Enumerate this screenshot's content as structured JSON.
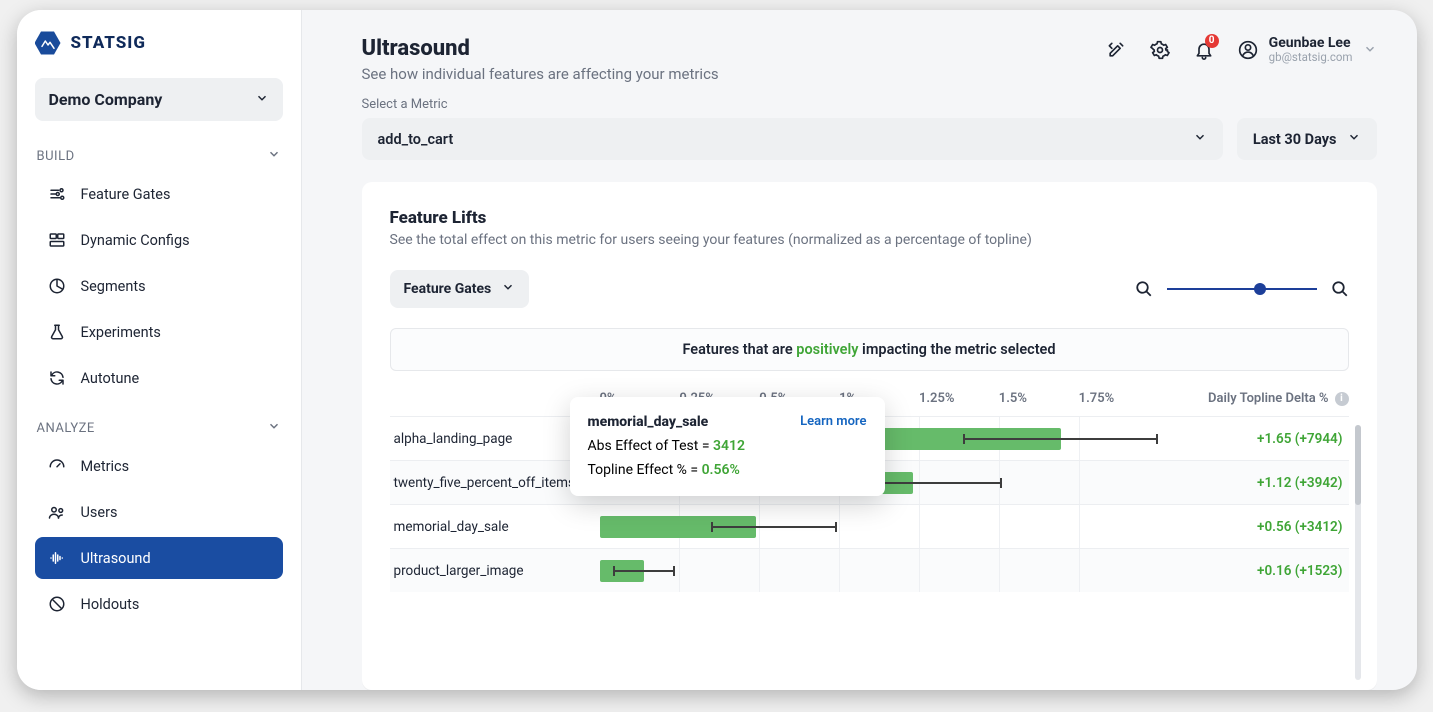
{
  "brand": {
    "name": "STATSIG"
  },
  "company_selector": {
    "label": "Demo Company"
  },
  "nav": {
    "sections": [
      {
        "label": "BUILD",
        "items": [
          {
            "id": "feature-gates",
            "label": "Feature Gates"
          },
          {
            "id": "dynamic-configs",
            "label": "Dynamic Configs"
          },
          {
            "id": "segments",
            "label": "Segments"
          },
          {
            "id": "experiments",
            "label": "Experiments"
          },
          {
            "id": "autotune",
            "label": "Autotune"
          }
        ]
      },
      {
        "label": "ANALYZE",
        "items": [
          {
            "id": "metrics",
            "label": "Metrics"
          },
          {
            "id": "users",
            "label": "Users"
          },
          {
            "id": "ultrasound",
            "label": "Ultrasound",
            "active": true
          },
          {
            "id": "holdouts",
            "label": "Holdouts"
          }
        ]
      }
    ]
  },
  "top": {
    "title": "Ultrasound",
    "subtitle": "See how individual features are affecting your metrics",
    "notification_count": "0",
    "user_name": "Geunbae Lee",
    "user_email": "gb@statsig.com"
  },
  "metric": {
    "label": "Select a Metric",
    "value": "add_to_cart",
    "range": "Last 30 Days"
  },
  "card": {
    "title": "Feature Lifts",
    "subtitle": "See the total effect on this metric for users seeing your features (normalized as a percentage of topline)",
    "filter": "Feature Gates",
    "impact_prefix": "Features that are ",
    "impact_word": "positively",
    "impact_suffix": " impacting the metric selected",
    "delta_header": "Daily Topline Delta %"
  },
  "chart_data": {
    "type": "bar",
    "xlabel": "",
    "ylabel": "",
    "xlim": [
      0,
      2.0
    ],
    "ticks": [
      "0%",
      "0.25%",
      "0.5%",
      "1%",
      "1.25%",
      "1.5%",
      "1.75%"
    ],
    "series": [
      {
        "name": "alpha_landing_page",
        "value_pct": 1.65,
        "ci_low_pct": 1.3,
        "ci_high_pct": 2.0,
        "abs_effect": 7944,
        "delta_text": "+1.65 (+7944)"
      },
      {
        "name": "twenty_five_percent_off_items",
        "value_pct": 1.12,
        "ci_low_pct": 0.8,
        "ci_high_pct": 1.44,
        "abs_effect": 3942,
        "delta_text": "+1.12 (+3942)"
      },
      {
        "name": "memorial_day_sale",
        "value_pct": 0.56,
        "ci_low_pct": 0.4,
        "ci_high_pct": 0.85,
        "abs_effect": 3412,
        "delta_text": "+0.56 (+3412)"
      },
      {
        "name": "product_larger_image",
        "value_pct": 0.16,
        "ci_low_pct": 0.05,
        "ci_high_pct": 0.27,
        "abs_effect": 1523,
        "delta_text": "+0.16 (+1523)"
      }
    ]
  },
  "tooltip": {
    "title": "memorial_day_sale",
    "link": "Learn more",
    "line1_label": "Abs Effect of Test = ",
    "line1_value": "3412",
    "line2_label": "Topline Effect % = ",
    "line2_value": "0.56%"
  }
}
